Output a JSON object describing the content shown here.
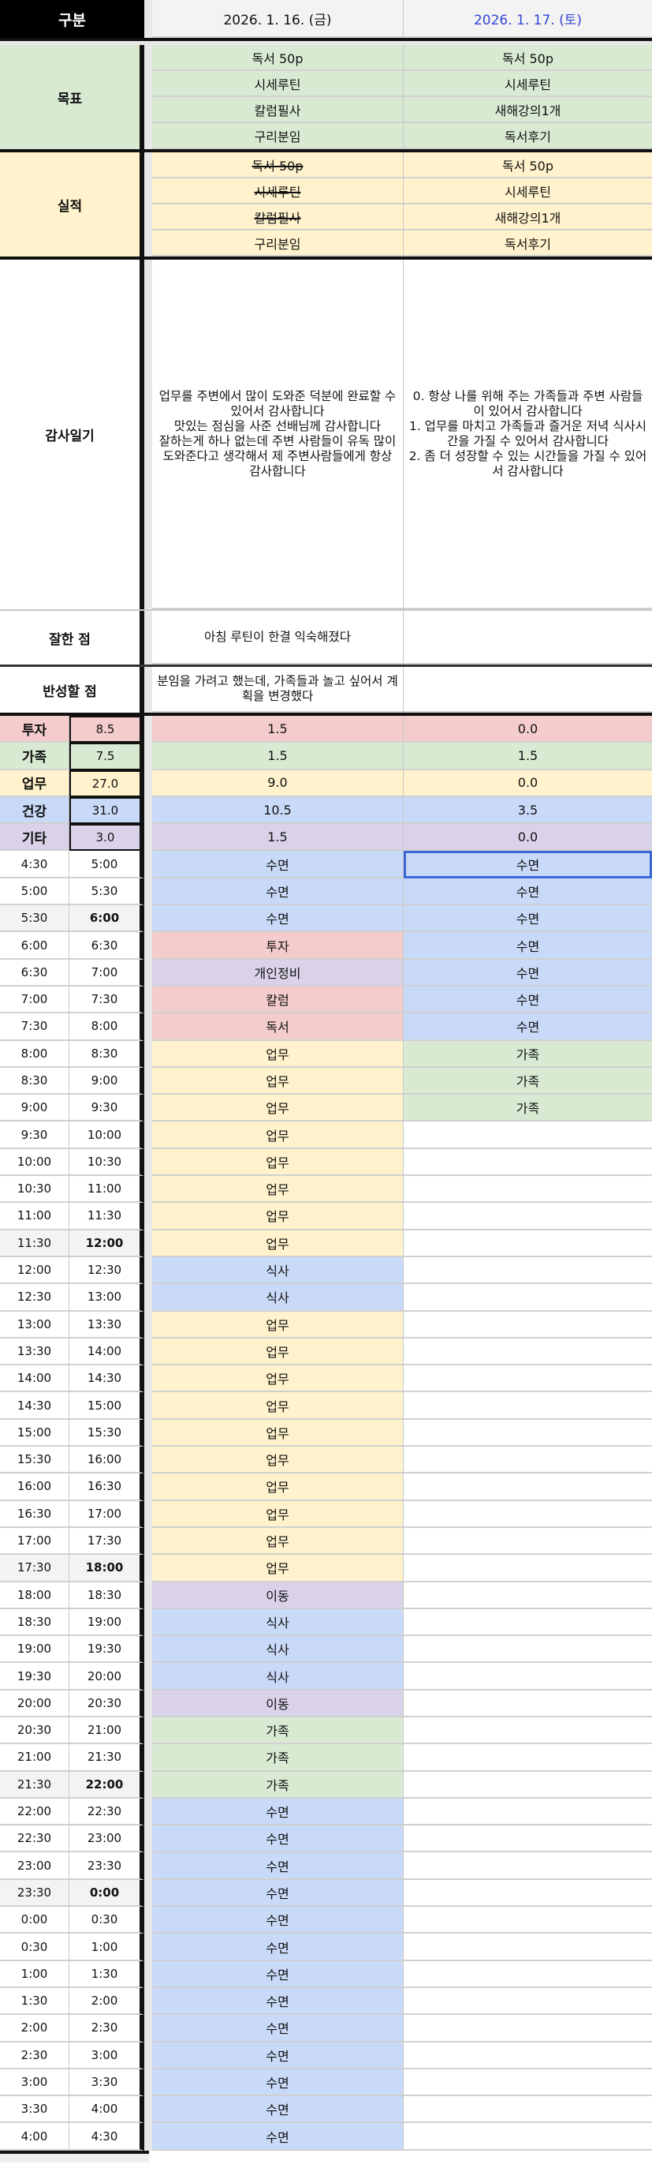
{
  "header": {
    "label": "구분",
    "day1": "2026. 1. 16. (금)",
    "day2": "2026. 1. 17. (토)"
  },
  "colors": {
    "투자": "#f4cccc",
    "가족": "#d9ead3",
    "업무": "#fff2cc",
    "건강": "#c9daf8",
    "기타": "#d9d2e9",
    "date2": "#3346d6"
  },
  "goals": {
    "label": "목표",
    "day1": [
      "독서 50p",
      "시세루틴",
      "칼럼필사",
      "구리분임"
    ],
    "day2": [
      "독서 50p",
      "시세루틴",
      "새해강의1개",
      "독서후기"
    ]
  },
  "results": {
    "label": "실적",
    "day1": [
      {
        "text": "독서 50p",
        "done": true
      },
      {
        "text": "시세루틴",
        "done": true
      },
      {
        "text": "칼럼필사",
        "done": true
      },
      {
        "text": "구리분임",
        "done": false
      }
    ],
    "day2": [
      {
        "text": "독서 50p",
        "done": false
      },
      {
        "text": "시세루틴",
        "done": false
      },
      {
        "text": "새해강의1개",
        "done": false
      },
      {
        "text": "독서후기",
        "done": false
      }
    ]
  },
  "gratitude": {
    "label": "감사일기",
    "day1": "업무를 주변에서 많이 도와준 덕분에 완료할 수 있어서 감사합니다\n맛있는 점심을 사준 선배님께 감사합니다\n잘하는게 하나 없는데 주변 사람들이 유독 많이 도와준다고 생각해서 제 주변사람들에게 항상 감사합니다",
    "day2": "0. 항상 나를 위해 주는 가족들과 주변 사람들이 있어서 감사합니다\n1. 업무를 마치고 가족들과 즐거운 저녁 식사시간을 가질 수 있어서 감사합니다\n2. 좀 더 성장할 수 있는 시간들을 가질 수 있어서 감사합니다"
  },
  "good": {
    "label": "잘한 점",
    "day1": "아침 루틴이 한결 익숙해졌다",
    "day2": ""
  },
  "reflect": {
    "label": "반성할 점",
    "day1": "분임을 가려고 했는데, 가족들과 놀고 싶어서 계획을 변경했다",
    "day2": ""
  },
  "categories": [
    {
      "name": "투자",
      "total": "8.5",
      "day1": "1.5",
      "day2": "0.0",
      "color": "red"
    },
    {
      "name": "가족",
      "total": "7.5",
      "day1": "1.5",
      "day2": "1.5",
      "color": "green"
    },
    {
      "name": "업무",
      "total": "27.0",
      "day1": "9.0",
      "day2": "0.0",
      "color": "yellow"
    },
    {
      "name": "건강",
      "total": "31.0",
      "day1": "10.5",
      "day2": "3.5",
      "color": "blue"
    },
    {
      "name": "기타",
      "total": "3.0",
      "day1": "1.5",
      "day2": "0.0",
      "color": "purple"
    }
  ],
  "times": [
    "4:30",
    "5:00",
    "5:30",
    "6:00",
    "6:30",
    "7:00",
    "7:30",
    "8:00",
    "8:30",
    "9:00",
    "9:30",
    "10:00",
    "10:30",
    "11:00",
    "11:30",
    "12:00",
    "12:30",
    "13:00",
    "13:30",
    "14:00",
    "14:30",
    "15:00",
    "15:30",
    "16:00",
    "16:30",
    "17:00",
    "17:30",
    "18:00",
    "18:30",
    "19:00",
    "19:30",
    "20:00",
    "20:30",
    "21:00",
    "21:30",
    "22:00",
    "22:30",
    "23:00",
    "23:30",
    "0:00",
    "0:30",
    "1:00",
    "1:30",
    "2:00",
    "2:30",
    "3:00",
    "3:30",
    "4:00",
    "4:30"
  ],
  "schedule_day1": [
    "수면",
    "수면",
    "수면",
    "투자",
    "개인정비",
    "칼럼",
    "독서",
    "업무",
    "업무",
    "업무",
    "업무",
    "업무",
    "업무",
    "업무",
    "업무",
    "식사",
    "식사",
    "업무",
    "업무",
    "업무",
    "업무",
    "업무",
    "업무",
    "업무",
    "업무",
    "업무",
    "업무",
    "이동",
    "식사",
    "식사",
    "식사",
    "이동",
    "가족",
    "가족",
    "가족",
    "수면",
    "수면",
    "수면",
    "수면",
    "수면",
    "수면",
    "수면",
    "수면",
    "수면",
    "수면",
    "수면",
    "수면",
    "수면"
  ],
  "schedule_day2": [
    "수면",
    "수면",
    "수면",
    "수면",
    "수면",
    "수면",
    "수면",
    "가족",
    "가족",
    "가족",
    "",
    "",
    "",
    "",
    "",
    "",
    "",
    "",
    "",
    "",
    "",
    "",
    "",
    "",
    "",
    "",
    "",
    "",
    "",
    "",
    "",
    "",
    "",
    "",
    "",
    "",
    "",
    "",
    "",
    "",
    "",
    "",
    "",
    "",
    "",
    "",
    "",
    ""
  ]
}
